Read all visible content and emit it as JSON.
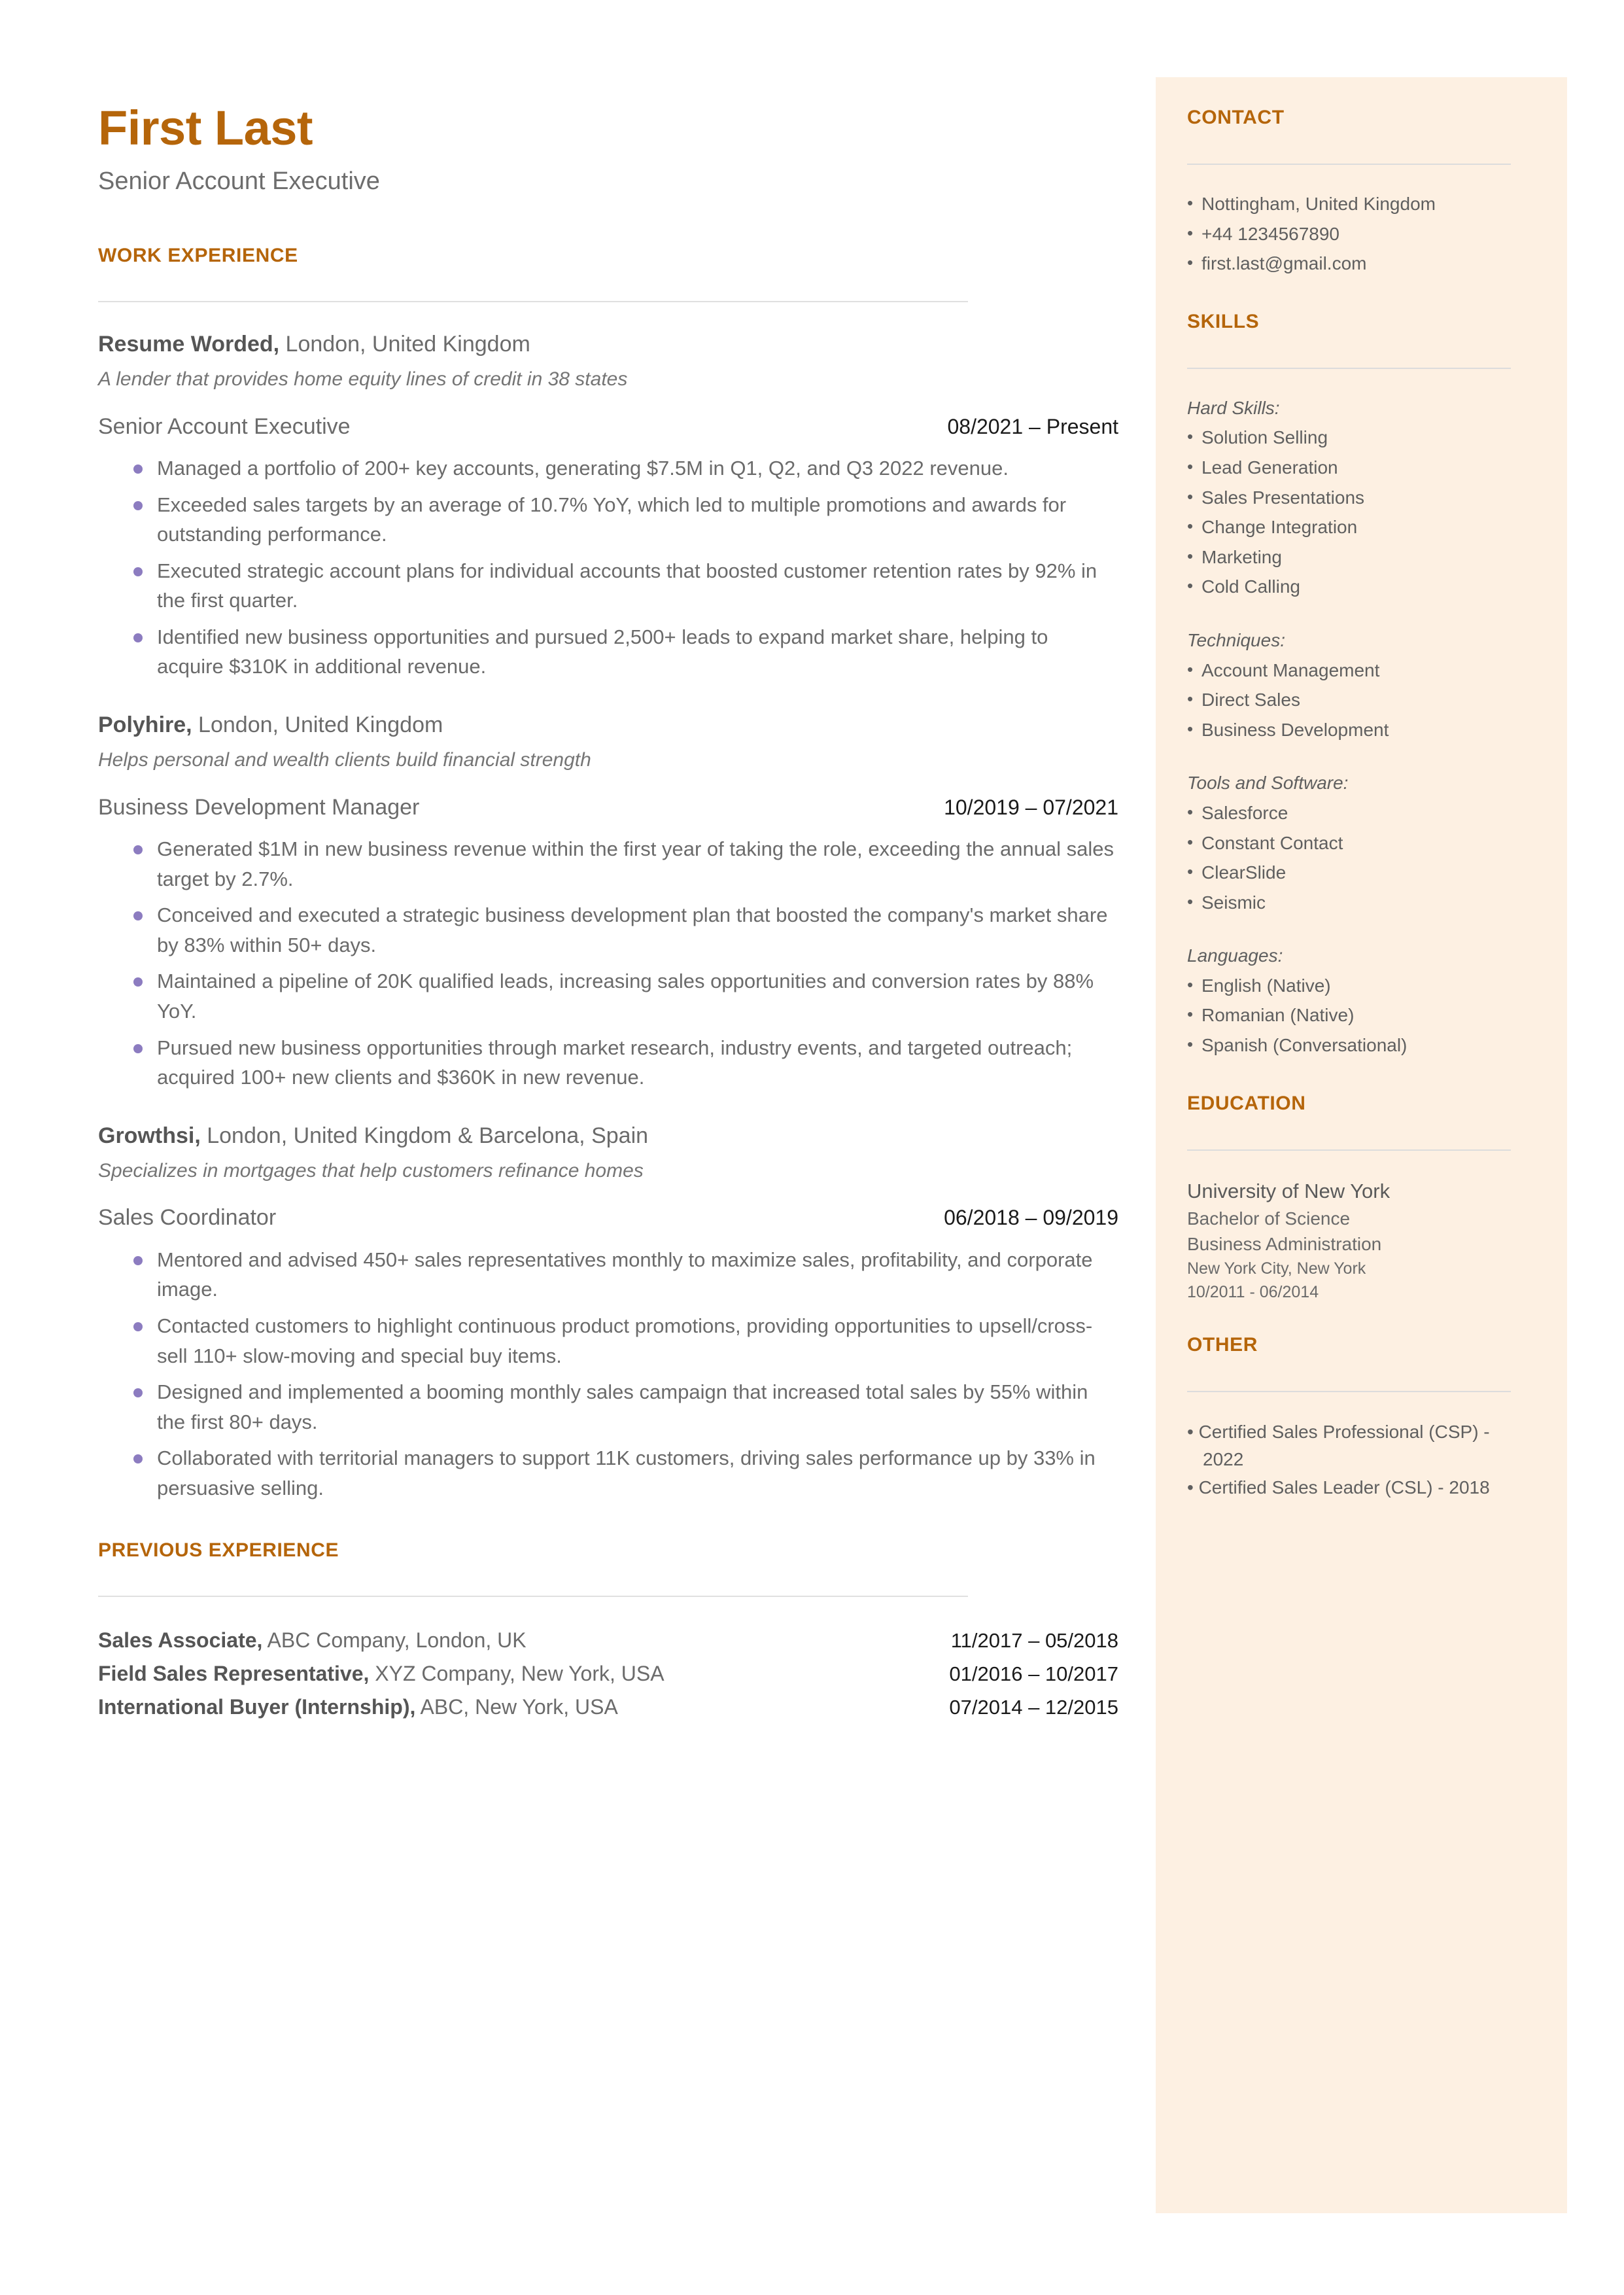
{
  "colors": {
    "accent": "#B5650A",
    "sidebar_bg": "#FDF0E2",
    "body_text": "#6B6B6B",
    "bullet": "#8C7CC0",
    "rule": "#E0E0E0"
  },
  "header": {
    "name": "First Last",
    "headline": "Senior Account Executive"
  },
  "sections": {
    "work_experience_heading": "WORK EXPERIENCE",
    "previous_experience_heading": "PREVIOUS EXPERIENCE",
    "contact_heading": "CONTACT",
    "skills_heading": "SKILLS",
    "education_heading": "EDUCATION",
    "other_heading": "OTHER"
  },
  "jobs": [
    {
      "company": "Resume Worded,",
      "location": " London, United Kingdom",
      "description": "A lender that provides home equity lines of credit in 38 states",
      "title": "Senior Account Executive",
      "dates": "08/2021 – Present",
      "bullets": [
        "Managed a portfolio of 200+ key accounts, generating $7.5M in Q1, Q2, and Q3 2022 revenue.",
        "Exceeded sales targets by an average of 10.7% YoY, which led to multiple promotions and awards for outstanding performance.",
        "Executed strategic account plans for individual accounts that boosted customer retention rates by 92% in the first quarter.",
        "Identified new business opportunities and pursued 2,500+ leads to expand market share, helping to acquire $310K in additional revenue."
      ]
    },
    {
      "company": "Polyhire,",
      "location": " London, United Kingdom",
      "description": "Helps personal and wealth clients build financial strength",
      "title": "Business Development Manager",
      "dates": "10/2019 – 07/2021",
      "bullets": [
        "Generated $1M in new business revenue within the first year of taking the role, exceeding the annual sales target by 2.7%.",
        "Conceived and executed a strategic business development plan that boosted the company's market share by 83% within 50+ days.",
        "Maintained a pipeline of 20K qualified leads, increasing sales opportunities and conversion rates by 88% YoY.",
        "Pursued new business opportunities through market research, industry events, and targeted outreach; acquired 100+ new clients and $360K in new revenue."
      ]
    },
    {
      "company": "Growthsi,",
      "location": " London, United Kingdom & Barcelona, Spain",
      "description": "Specializes in mortgages that help customers refinance homes",
      "title": "Sales Coordinator",
      "dates": "06/2018 – 09/2019",
      "bullets": [
        "Mentored and advised 450+ sales representatives monthly to maximize sales, profitability, and corporate image.",
        "Contacted customers to highlight continuous product promotions, providing opportunities to upsell/cross-sell 110+ slow-moving and special buy items.",
        "Designed and implemented a booming monthly sales campaign that increased total sales by 55% within the first 80+ days.",
        "Collaborated with territorial managers to support 11K customers, driving sales performance up by 33% in persuasive selling."
      ]
    }
  ],
  "previous_experience": [
    {
      "title": "Sales Associate,",
      "detail": " ABC Company, London, UK",
      "dates": "11/2017 – 05/2018"
    },
    {
      "title": "Field Sales Representative,",
      "detail": " XYZ Company, New York, USA",
      "dates": "01/2016 – 10/2017"
    },
    {
      "title": "International Buyer (Internship),",
      "detail": " ABC, New York, USA",
      "dates": "07/2014 – 12/2015"
    }
  ],
  "contact": {
    "items": [
      "Nottingham, United Kingdom",
      "+44 1234567890",
      "first.last@gmail.com"
    ]
  },
  "skills": {
    "groups": [
      {
        "label": "Hard Skills:",
        "items": [
          "Solution Selling",
          "Lead Generation",
          "Sales Presentations",
          "Change Integration",
          "Marketing",
          "Cold Calling"
        ]
      },
      {
        "label": "Techniques:",
        "items": [
          "Account Management",
          "Direct Sales",
          "Business Development"
        ]
      },
      {
        "label": "Tools and Software:",
        "items": [
          "Salesforce",
          "Constant Contact",
          "ClearSlide",
          "Seismic"
        ]
      },
      {
        "label": "Languages:",
        "items": [
          "English (Native)",
          "Romanian (Native)",
          "Spanish (Conversational)"
        ]
      }
    ]
  },
  "education": {
    "school": "University of New York",
    "degree": "Bachelor of Science",
    "field": "Business Administration",
    "location": "New York City, New York",
    "dates": "10/2011 - 06/2014"
  },
  "other": {
    "items": [
      "Certified Sales Professional (CSP) - 2022",
      "Certified Sales Leader (CSL) - 2018"
    ]
  },
  "icons": {
    "bullet_dot": "•"
  }
}
